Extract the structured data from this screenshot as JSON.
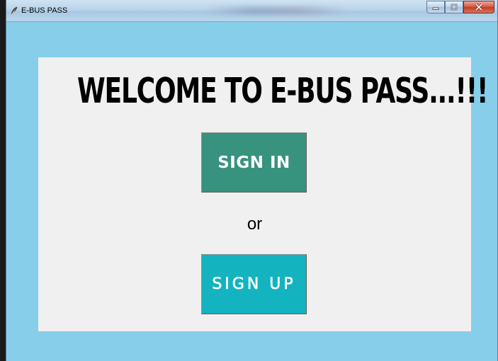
{
  "window": {
    "title": "E-BUS PASS",
    "controls": {
      "minimize_icon": "minimize-icon",
      "maximize_icon": "maximize-icon",
      "close_icon": "close-icon"
    }
  },
  "main": {
    "heading": "WELCOME TO E-BUS PASS...!!!",
    "signin_label": "SIGN IN",
    "separator": "or",
    "signup_label": "SIGN UP"
  },
  "colors": {
    "window_background": "#87ceeb",
    "panel_background": "#f0f0f0",
    "signin_button": "#37927e",
    "signup_button": "#13b3c0",
    "button_text": "#ffffff"
  }
}
